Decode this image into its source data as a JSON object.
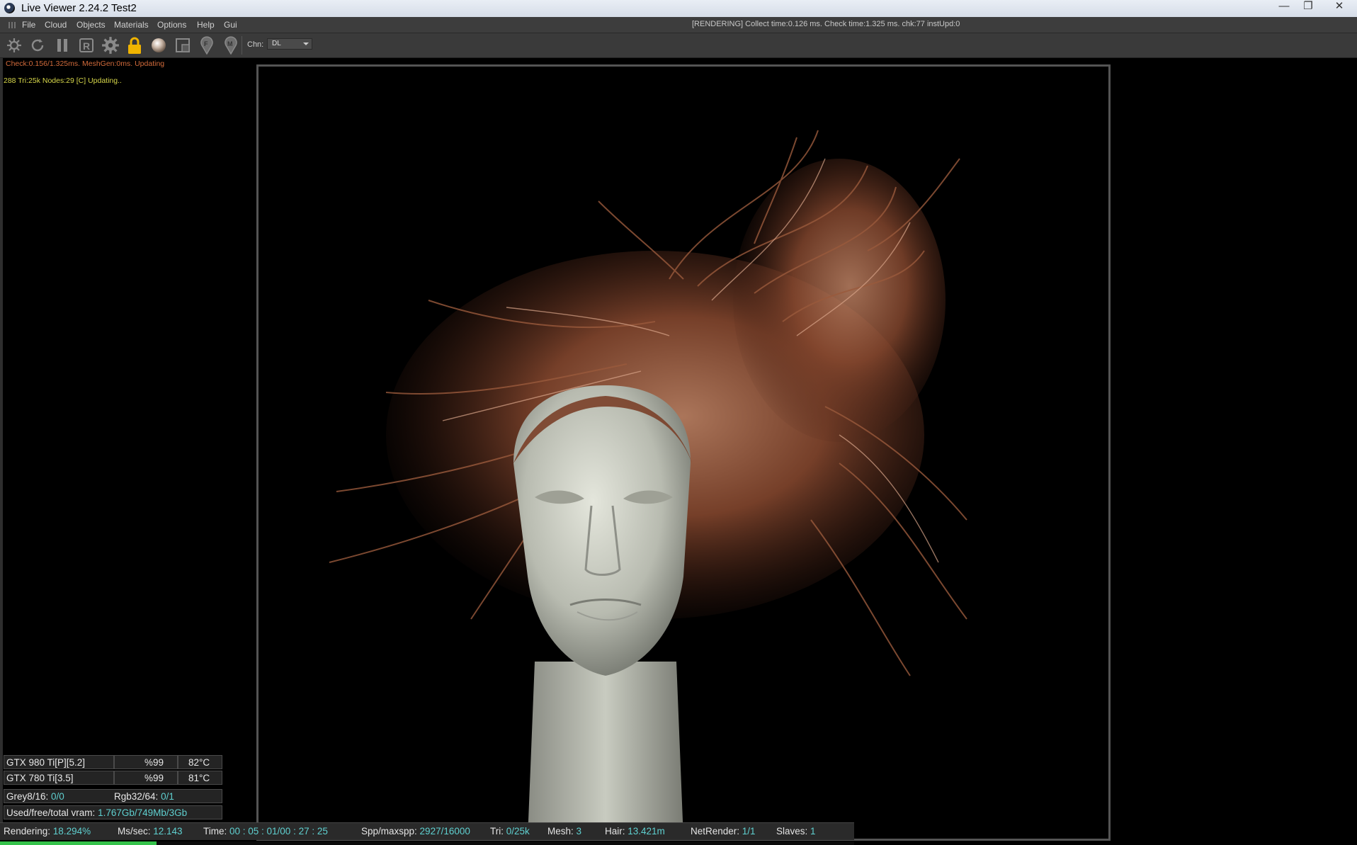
{
  "window": {
    "title": "Live Viewer 2.24.2 Test2"
  },
  "menubar": {
    "items": [
      "File",
      "Cloud",
      "Objects",
      "Materials",
      "Options",
      "Help",
      "Gui"
    ],
    "status": "[RENDERING] Collect time:0.126 ms.  Check time:1.325 ms.  chk:77  instUpd:0"
  },
  "toolbar": {
    "icons": [
      "render-settings-icon",
      "restart-icon",
      "pause-icon",
      "region-render-icon",
      "settings-gear-icon",
      "lock-icon",
      "material-ball-icon",
      "viewport-icon",
      "focus-picker-icon",
      "material-picker-icon"
    ],
    "chn_label": "Chn:",
    "chn_value": "DL"
  },
  "overlay": {
    "check_line": "Check:0.156/1.325ms. MeshGen:0ms. Updating",
    "tri_line": "288  Tri:25k Nodes:29  [C] Updating.."
  },
  "gpus": [
    {
      "name": "GTX 980 Ti[P][5.2]",
      "usage": "%99",
      "temp": "82°C"
    },
    {
      "name": "GTX 780 Ti[3.5]",
      "usage": "%99",
      "temp": "81°C"
    }
  ],
  "memory": {
    "grey_label": "Grey8/16: ",
    "grey_value": "0/0",
    "rgb_label": "Rgb32/64: ",
    "rgb_value": "0/1",
    "vram_label": "Used/free/total vram: ",
    "vram_value": "1.767Gb/749Mb/3Gb"
  },
  "status": {
    "rendering_label": "Rendering: ",
    "rendering_value": "18.294%",
    "mssec_label": "Ms/sec: ",
    "mssec_value": "12.143",
    "time_label": "Time: ",
    "time_value": "00 : 05 : 01/00 : 27 : 25",
    "spp_label": "Spp/maxspp: ",
    "spp_value": "2927/16000",
    "tri_label": "Tri: ",
    "tri_value": "0/25k",
    "mesh_label": "Mesh: ",
    "mesh_value": "3",
    "hair_label": "Hair: ",
    "hair_value": "13.421m",
    "netrender_label": "NetRender: ",
    "netrender_value": "1/1",
    "slaves_label": "Slaves: ",
    "slaves_value": "1",
    "progress_fraction": 0.18294
  },
  "colors": {
    "accent_value": "#5fd0d0",
    "progress": "#34c24a",
    "warning_text": "#d26b3b",
    "info_text": "#d6d64a",
    "lock_icon": "#f0b400"
  }
}
